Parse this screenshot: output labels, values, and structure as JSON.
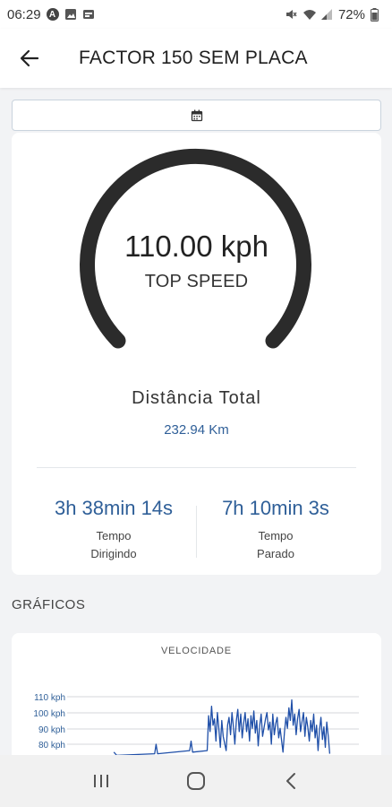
{
  "status_bar": {
    "time": "06:29",
    "battery": "72%"
  },
  "header": {
    "title": "FACTOR 150 SEM PLACA"
  },
  "summary": {
    "top_speed_value": "110.00 kph",
    "top_speed_label": "TOP SPEED",
    "distance_label": "Distância Total",
    "distance_value": "232.94 Km",
    "driving_time": "3h 38min 14s",
    "driving_label_1": "Tempo",
    "driving_label_2": "Dirigindo",
    "stopped_time": "7h 10min 3s",
    "stopped_label_1": "Tempo",
    "stopped_label_2": "Parado"
  },
  "charts_section": {
    "title": "GRÁFICOS"
  },
  "chart_data": {
    "type": "line",
    "title": "VELOCIDADE",
    "y_ticks": [
      "110 kph",
      "100 kph",
      "90 kph",
      "80 kph"
    ],
    "ylim": [
      70,
      115
    ],
    "grid": true,
    "series": [
      {
        "color": "#1f4fa8",
        "values": [
          [
            0.16,
            75
          ],
          [
            0.17,
            73
          ],
          [
            0.3,
            74
          ],
          [
            0.305,
            80
          ],
          [
            0.31,
            74
          ],
          [
            0.42,
            76
          ],
          [
            0.425,
            82
          ],
          [
            0.43,
            75
          ],
          [
            0.48,
            76
          ],
          [
            0.485,
            98
          ],
          [
            0.49,
            88
          ],
          [
            0.495,
            104
          ],
          [
            0.5,
            92
          ],
          [
            0.505,
            96
          ],
          [
            0.51,
            82
          ],
          [
            0.515,
            100
          ],
          [
            0.52,
            90
          ],
          [
            0.525,
            78
          ],
          [
            0.53,
            95
          ],
          [
            0.535,
            85
          ],
          [
            0.545,
            76
          ],
          [
            0.55,
            92
          ],
          [
            0.555,
            97
          ],
          [
            0.56,
            86
          ],
          [
            0.565,
            100
          ],
          [
            0.57,
            91
          ],
          [
            0.575,
            80
          ],
          [
            0.58,
            95
          ],
          [
            0.585,
            102
          ],
          [
            0.59,
            88
          ],
          [
            0.595,
            99
          ],
          [
            0.6,
            84
          ],
          [
            0.605,
            93
          ],
          [
            0.61,
            100
          ],
          [
            0.615,
            88
          ],
          [
            0.62,
            96
          ],
          [
            0.625,
            82
          ],
          [
            0.63,
            98
          ],
          [
            0.635,
            90
          ],
          [
            0.64,
            101
          ],
          [
            0.645,
            87
          ],
          [
            0.65,
            95
          ],
          [
            0.655,
            79
          ],
          [
            0.66,
            92
          ],
          [
            0.665,
            99
          ],
          [
            0.67,
            85
          ],
          [
            0.68,
            96
          ],
          [
            0.685,
            100
          ],
          [
            0.69,
            89
          ],
          [
            0.695,
            94
          ],
          [
            0.7,
            80
          ],
          [
            0.705,
            99
          ],
          [
            0.71,
            86
          ],
          [
            0.715,
            93
          ],
          [
            0.72,
            97
          ],
          [
            0.725,
            84
          ],
          [
            0.73,
            90
          ],
          [
            0.74,
            75
          ],
          [
            0.745,
            88
          ],
          [
            0.75,
            97
          ],
          [
            0.755,
            90
          ],
          [
            0.76,
            103
          ],
          [
            0.765,
            95
          ],
          [
            0.77,
            108
          ],
          [
            0.775,
            92
          ],
          [
            0.78,
            99
          ],
          [
            0.785,
            86
          ],
          [
            0.79,
            96
          ],
          [
            0.795,
            102
          ],
          [
            0.8,
            88
          ],
          [
            0.805,
            94
          ],
          [
            0.81,
            100
          ],
          [
            0.815,
            85
          ],
          [
            0.82,
            97
          ],
          [
            0.825,
            91
          ],
          [
            0.83,
            82
          ],
          [
            0.835,
            95
          ],
          [
            0.84,
            88
          ],
          [
            0.845,
            99
          ],
          [
            0.85,
            84
          ],
          [
            0.855,
            92
          ],
          [
            0.86,
            76
          ],
          [
            0.865,
            89
          ],
          [
            0.87,
            97
          ],
          [
            0.875,
            83
          ],
          [
            0.88,
            91
          ],
          [
            0.885,
            78
          ],
          [
            0.89,
            94
          ],
          [
            0.895,
            85
          ],
          [
            0.9,
            74
          ]
        ]
      }
    ]
  }
}
